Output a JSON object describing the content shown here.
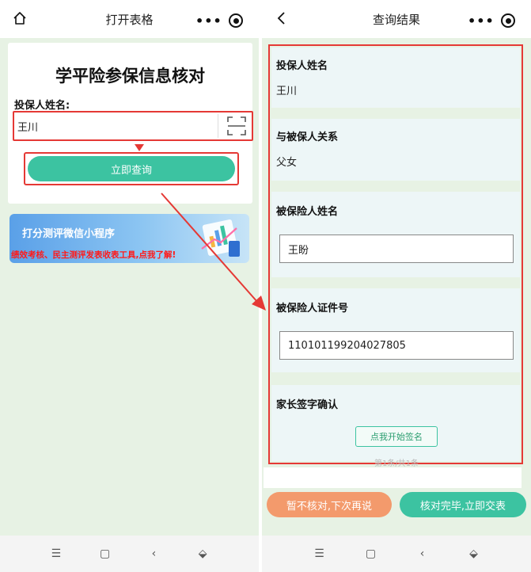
{
  "left": {
    "topbar": {
      "title": "打开表格",
      "capsule_dots": "•••"
    },
    "form": {
      "heading": "学平险参保信息核对",
      "name_label": "投保人姓名:",
      "name_value": "王川",
      "query_button": "立即查询"
    },
    "banner": {
      "title": "打分测评微信小程序",
      "subtitle": "绩效考核、民主测评发表收表工具,点我了解!"
    },
    "bottom_nav": [
      "☰",
      "▢",
      "‹",
      "⬙"
    ]
  },
  "right": {
    "topbar": {
      "title": "查询结果",
      "capsule_dots": "•••"
    },
    "fields": {
      "policy_holder_label": "投保人姓名",
      "policy_holder_value": "王川",
      "relation_label": "与被保人关系",
      "relation_value": "父女",
      "insured_name_label": "被保险人姓名",
      "insured_name_value": "王盼",
      "insured_id_label": "被保险人证件号",
      "insured_id_value": "110101199204027805",
      "signature_label": "家长签字确认",
      "sign_button": "点我开始签名"
    },
    "pager": "第1条/共1条",
    "actions": {
      "later": "暂不核对,下次再说",
      "done": "核对完毕,立即交表"
    },
    "bottom_nav": [
      "☰",
      "▢",
      "‹",
      "⬙"
    ]
  },
  "colors": {
    "accent_green": "#3cc3a1",
    "highlight_red": "#e53935",
    "later_orange": "#f39a6c",
    "page_bg": "#e7f2e4"
  }
}
